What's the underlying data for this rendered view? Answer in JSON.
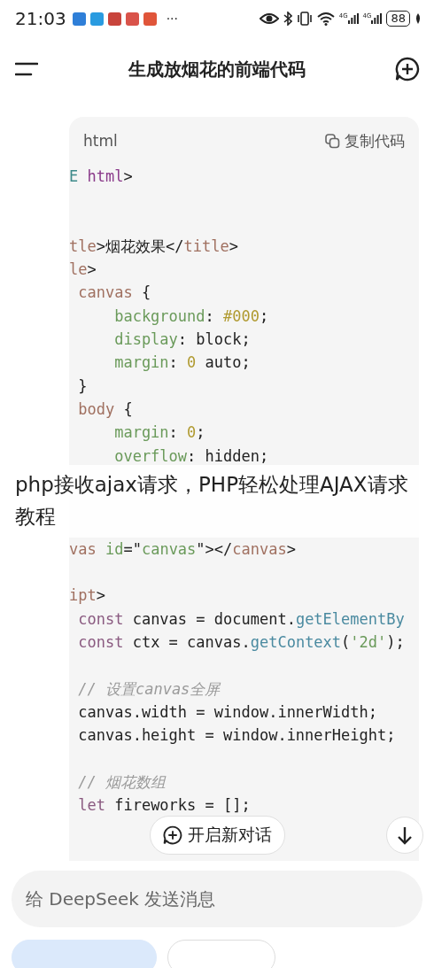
{
  "status_bar": {
    "time": "21:03",
    "more": "···",
    "app_icons": [
      {
        "color": "#2f7fd8"
      },
      {
        "color": "#2a9be0"
      },
      {
        "color": "#c8443c"
      },
      {
        "color": "#d9534a"
      },
      {
        "color": "#e0553a"
      }
    ],
    "network_labels": [
      "4G",
      "4G"
    ],
    "battery": "88"
  },
  "header": {
    "title": "生成放烟花的前端代码"
  },
  "code_block": {
    "language": "html",
    "copy_label": "复制代码",
    "lines": [
      {
        "kind": "code",
        "tokens": [
          {
            "text": "E ",
            "kind": "doctype"
          },
          {
            "text": "html",
            "kind": "tag"
          },
          {
            "text": ">",
            "kind": "plain"
          }
        ]
      },
      {
        "kind": "blank"
      },
      {
        "kind": "blank"
      },
      {
        "kind": "code",
        "tokens": [
          {
            "text": "tle",
            "kind": "tagname"
          },
          {
            "text": ">烟花效果</",
            "kind": "plain"
          },
          {
            "text": "title",
            "kind": "tagname"
          },
          {
            "text": ">",
            "kind": "plain"
          }
        ]
      },
      {
        "kind": "code",
        "tokens": [
          {
            "text": "le",
            "kind": "tagname"
          },
          {
            "text": ">",
            "kind": "plain"
          }
        ]
      },
      {
        "kind": "code",
        "tokens": [
          {
            "text": " canvas",
            "kind": "tagname"
          },
          {
            "text": " {",
            "kind": "plain"
          }
        ]
      },
      {
        "kind": "code",
        "tokens": [
          {
            "text": "     background",
            "kind": "prop"
          },
          {
            "text": ": ",
            "kind": "plain"
          },
          {
            "text": "#000",
            "kind": "num"
          },
          {
            "text": ";",
            "kind": "plain"
          }
        ]
      },
      {
        "kind": "code",
        "tokens": [
          {
            "text": "     display",
            "kind": "prop"
          },
          {
            "text": ": block;",
            "kind": "plain"
          }
        ]
      },
      {
        "kind": "code",
        "tokens": [
          {
            "text": "     margin",
            "kind": "prop"
          },
          {
            "text": ": ",
            "kind": "plain"
          },
          {
            "text": "0",
            "kind": "num"
          },
          {
            "text": " auto;",
            "kind": "plain"
          }
        ]
      },
      {
        "kind": "code",
        "tokens": [
          {
            "text": " }",
            "kind": "plain"
          }
        ]
      },
      {
        "kind": "code",
        "tokens": [
          {
            "text": " body",
            "kind": "tagname"
          },
          {
            "text": " {",
            "kind": "plain"
          }
        ]
      },
      {
        "kind": "code",
        "tokens": [
          {
            "text": "     margin",
            "kind": "prop"
          },
          {
            "text": ": ",
            "kind": "plain"
          },
          {
            "text": "0",
            "kind": "num"
          },
          {
            "text": ";",
            "kind": "plain"
          }
        ]
      },
      {
        "kind": "code",
        "tokens": [
          {
            "text": "     overflow",
            "kind": "prop"
          },
          {
            "text": ": hidden;",
            "kind": "plain"
          }
        ]
      },
      {
        "kind": "blank"
      },
      {
        "kind": "blank"
      },
      {
        "kind": "blank"
      },
      {
        "kind": "code",
        "tokens": [
          {
            "text": "vas ",
            "kind": "tagname"
          },
          {
            "text": "id",
            "kind": "prop"
          },
          {
            "text": "=\"",
            "kind": "plain"
          },
          {
            "text": "canvas",
            "kind": "prop"
          },
          {
            "text": "\"></",
            "kind": "plain"
          },
          {
            "text": "canvas",
            "kind": "tagname"
          },
          {
            "text": ">",
            "kind": "plain"
          }
        ]
      },
      {
        "kind": "blank"
      },
      {
        "kind": "code",
        "tokens": [
          {
            "text": "ipt",
            "kind": "tagname"
          },
          {
            "text": ">",
            "kind": "plain"
          }
        ]
      },
      {
        "kind": "code",
        "tokens": [
          {
            "text": " const",
            "kind": "keyword"
          },
          {
            "text": " canvas = document.",
            "kind": "plain"
          },
          {
            "text": "getElementBy",
            "kind": "func"
          }
        ]
      },
      {
        "kind": "code",
        "tokens": [
          {
            "text": " const",
            "kind": "keyword"
          },
          {
            "text": " ctx = canvas.",
            "kind": "plain"
          },
          {
            "text": "getContext",
            "kind": "func"
          },
          {
            "text": "(",
            "kind": "plain"
          },
          {
            "text": "'2d'",
            "kind": "prop"
          },
          {
            "text": ");",
            "kind": "plain"
          }
        ]
      },
      {
        "kind": "blank"
      },
      {
        "kind": "code",
        "tokens": [
          {
            "text": " // 设置canvas全屏",
            "kind": "comment"
          }
        ]
      },
      {
        "kind": "code",
        "tokens": [
          {
            "text": " canvas.width = window.innerWidth;",
            "kind": "plain"
          }
        ]
      },
      {
        "kind": "code",
        "tokens": [
          {
            "text": " canvas.height = window.innerHeight;",
            "kind": "plain"
          }
        ]
      },
      {
        "kind": "blank"
      },
      {
        "kind": "code",
        "tokens": [
          {
            "text": " // 烟花数组",
            "kind": "comment"
          }
        ]
      },
      {
        "kind": "code",
        "tokens": [
          {
            "text": " let",
            "kind": "keyword"
          },
          {
            "text": " fireworks = [];",
            "kind": "plain"
          }
        ]
      }
    ]
  },
  "overlay_caption": "php接收ajax请求，PHP轻松处理AJAX请求教程",
  "new_chat_button": "开启新对话",
  "message_input": {
    "placeholder": "给 DeepSeek 发送消息"
  },
  "mode_chips": [
    {
      "selected": true
    },
    {
      "selected": false
    }
  ]
}
